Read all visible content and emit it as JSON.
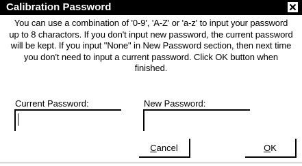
{
  "window": {
    "title": "Calibration Password",
    "close_icon": "close-icon"
  },
  "message": "You can use a combination of '0-9', 'A-Z' or 'a-z' to input your password up to 8 charactors. If you don't input new password, the current password will be kept. If you input \"None\" in New Password section, then next time you don't need to input a current password. Click OK button when finished.",
  "fields": {
    "current": {
      "label": "Current Password:",
      "value": ""
    },
    "new": {
      "label": "New Password:",
      "value": ""
    }
  },
  "buttons": {
    "cancel": {
      "mnemonic": "C",
      "rest": "ancel"
    },
    "ok": {
      "mnemonic": "O",
      "rest": "K"
    }
  }
}
